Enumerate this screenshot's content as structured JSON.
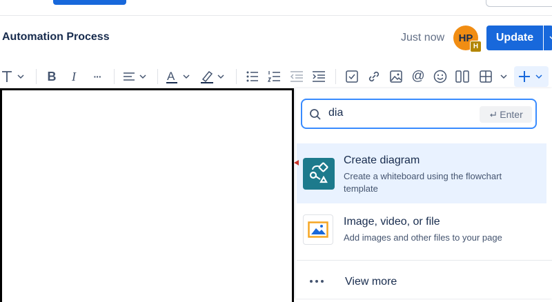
{
  "page": {
    "title": "Automation Process",
    "save_status": "Just now"
  },
  "user": {
    "avatar_initials": "HP",
    "avatar_badge": "H"
  },
  "header": {
    "update_label": "Update"
  },
  "toolbar": {
    "items": [
      {
        "name": "text-style",
        "icon": "text-style-icon",
        "has_chevron": true
      },
      {
        "name": "bold",
        "icon": "bold-icon",
        "glyph": "B"
      },
      {
        "name": "italic",
        "icon": "italic-icon",
        "glyph": "I"
      },
      {
        "name": "more-formatting",
        "icon": "more-icon",
        "glyph": "···"
      },
      {
        "name": "alignment",
        "icon": "align-icon",
        "has_chevron": true
      },
      {
        "name": "text-color",
        "icon": "text-color-icon",
        "glyph": "A",
        "has_chevron": true
      },
      {
        "name": "highlight",
        "icon": "highlight-icon",
        "has_chevron": true
      },
      {
        "name": "bullet-list",
        "icon": "bullet-list-icon"
      },
      {
        "name": "numbered-list",
        "icon": "numbered-list-icon"
      },
      {
        "name": "outdent",
        "icon": "outdent-icon"
      },
      {
        "name": "indent",
        "icon": "indent-icon"
      },
      {
        "name": "task",
        "icon": "checkbox-icon"
      },
      {
        "name": "link",
        "icon": "link-icon"
      },
      {
        "name": "image",
        "icon": "image-icon"
      },
      {
        "name": "mention",
        "icon": "at-icon",
        "glyph": "@"
      },
      {
        "name": "emoji",
        "icon": "emoji-icon"
      },
      {
        "name": "layouts",
        "icon": "columns-icon"
      },
      {
        "name": "table",
        "icon": "table-icon",
        "has_chevron": true
      },
      {
        "name": "insert",
        "icon": "plus-icon",
        "has_chevron": true
      }
    ]
  },
  "insert_panel": {
    "search": {
      "value": "dia",
      "hint": "Enter"
    },
    "items": [
      {
        "title": "Create diagram",
        "description": "Create a whiteboard using the flowchart template",
        "icon": "diagram-icon"
      },
      {
        "title": "Image, video, or file",
        "description": "Add images and other files to your page",
        "icon": "image-file-icon"
      }
    ],
    "view_more_label": "View more"
  },
  "colors": {
    "primary": "#1868db",
    "avatar": "#f18d13",
    "selected_row": "#e9f2ff",
    "diagram_icon": "#1d7a8c"
  }
}
